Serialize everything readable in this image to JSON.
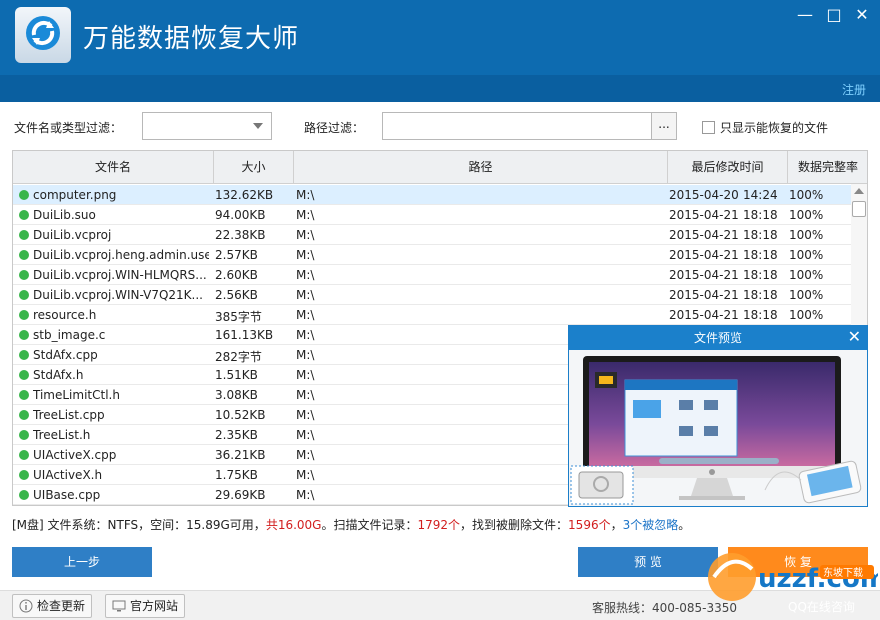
{
  "app": {
    "title": "万能数据恢复大师",
    "register": "注册",
    "window_controls": {
      "minimize": "—",
      "maximize": "□",
      "close": "✕"
    }
  },
  "filters": {
    "name_label": "文件名或类型过滤：",
    "name_value": "",
    "path_label": "路径过滤：",
    "path_value": "",
    "browse": "...",
    "only_recoverable_label": "只显示能恢复的文件",
    "only_recoverable_checked": false
  },
  "table": {
    "headers": [
      "文件名",
      "大小",
      "路径",
      "最后修改时间",
      "数据完整率"
    ],
    "rows": [
      {
        "name": "computer.png",
        "size": "132.62KB",
        "path": "M:\\",
        "date": "2015-04-20",
        "time": "14:24",
        "integrity": "100%"
      },
      {
        "name": "DuiLib.suo",
        "size": "94.00KB",
        "path": "M:\\",
        "date": "2015-04-21",
        "time": "18:18",
        "integrity": "100%"
      },
      {
        "name": "DuiLib.vcproj",
        "size": "22.38KB",
        "path": "M:\\",
        "date": "2015-04-21",
        "time": "18:18",
        "integrity": "100%"
      },
      {
        "name": "DuiLib.vcproj.heng.admin.user",
        "size": "2.57KB",
        "path": "M:\\",
        "date": "2015-04-21",
        "time": "18:18",
        "integrity": "100%"
      },
      {
        "name": "DuiLib.vcproj.WIN-HLMQRS...",
        "size": "2.60KB",
        "path": "M:\\",
        "date": "2015-04-21",
        "time": "18:18",
        "integrity": "100%"
      },
      {
        "name": "DuiLib.vcproj.WIN-V7Q21K...",
        "size": "2.56KB",
        "path": "M:\\",
        "date": "2015-04-21",
        "time": "18:18",
        "integrity": "100%"
      },
      {
        "name": "resource.h",
        "size": "385字节",
        "path": "M:\\",
        "date": "2015-04-21",
        "time": "18:18",
        "integrity": "100%"
      },
      {
        "name": "stb_image.c",
        "size": "161.13KB",
        "path": "M:\\",
        "date": "",
        "time": "",
        "integrity": ""
      },
      {
        "name": "StdAfx.cpp",
        "size": "282字节",
        "path": "M:\\",
        "date": "",
        "time": "",
        "integrity": ""
      },
      {
        "name": "StdAfx.h",
        "size": "1.51KB",
        "path": "M:\\",
        "date": "",
        "time": "",
        "integrity": ""
      },
      {
        "name": "TimeLimitCtl.h",
        "size": "3.08KB",
        "path": "M:\\",
        "date": "",
        "time": "",
        "integrity": ""
      },
      {
        "name": "TreeList.cpp",
        "size": "10.52KB",
        "path": "M:\\",
        "date": "",
        "time": "",
        "integrity": ""
      },
      {
        "name": "TreeList.h",
        "size": "2.35KB",
        "path": "M:\\",
        "date": "",
        "time": "",
        "integrity": ""
      },
      {
        "name": "UIActiveX.cpp",
        "size": "36.21KB",
        "path": "M:\\",
        "date": "",
        "time": "",
        "integrity": ""
      },
      {
        "name": "UIActiveX.h",
        "size": "1.75KB",
        "path": "M:\\",
        "date": "",
        "time": "",
        "integrity": ""
      },
      {
        "name": "UIBase.cpp",
        "size": "29.69KB",
        "path": "M:\\",
        "date": "",
        "time": "",
        "integrity": ""
      }
    ]
  },
  "preview": {
    "title": "文件预览",
    "close": "✕"
  },
  "status": {
    "part1": "[M盘] 文件系统：NTFS，空间：15.89G可用，",
    "total": "共16.00G",
    "part2": "。扫描文件记录：",
    "scanned": "1792个",
    "part3": "，找到被删除文件：",
    "deleted": "1596个",
    "part4": "，",
    "ignored": "3个被忽略",
    "part5": "。"
  },
  "buttons": {
    "prev": "上一步",
    "preview": "预 览",
    "recover": "恢 复"
  },
  "footer": {
    "check_update": "检查更新",
    "website": "官方网站",
    "hotline": "客服热线：400-085-3350",
    "qq": "QQ在线咨询"
  },
  "watermark": {
    "logo": "uzzf.com",
    "tag": "东坡下载"
  },
  "colors": {
    "header_blue": "#0d6bb0",
    "accent_blue": "#2f7fc6",
    "orange": "#ff8a1c",
    "ok_green": "#38b54a",
    "alert_red": "#d21e1e"
  }
}
